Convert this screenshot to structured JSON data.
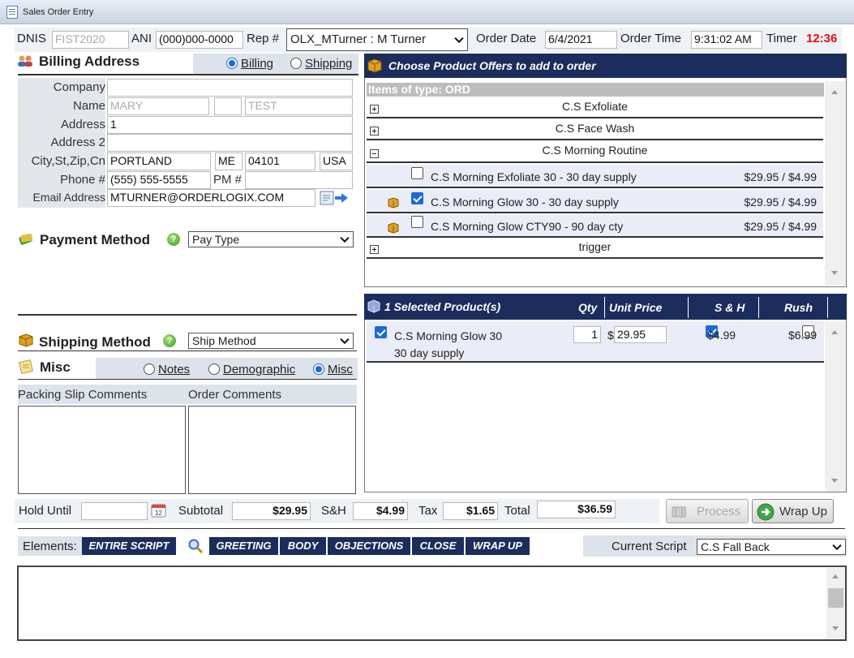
{
  "window": {
    "title": "Sales Order Entry"
  },
  "header": {
    "dnis_label": "DNIS",
    "dnis_value": "FIST2020",
    "ani_label": "ANI",
    "ani_value": "(000)000-0000",
    "rep_label": "Rep #",
    "rep_value": "OLX_MTurner : M Turner",
    "order_date_label": "Order Date",
    "order_date_value": "6/4/2021",
    "order_time_label": "Order Time",
    "order_time_value": "9:31:02 AM",
    "timer_label": "Timer",
    "timer_value": "12:36",
    "timer_color": "#e01010"
  },
  "billing": {
    "title": "Billing Address",
    "radio_billing": "Billing",
    "radio_shipping": "Shipping",
    "company_label": "Company",
    "company_value": "",
    "name_label": "Name",
    "first_name": "MARY",
    "middle_initial": "",
    "last_name": "TEST",
    "address_label": "Address",
    "address_value": "1",
    "address2_label": "Address 2",
    "address2_value": "",
    "city_label": "City,St,Zip,Cn",
    "city_value": "PORTLAND",
    "state_value": "ME",
    "zip_value": "04101",
    "country_value": "USA",
    "phone_label": "Phone #",
    "phone_value": "(555) 555-5555",
    "pm_label": "PM #",
    "pm_value": "",
    "email_label": "Email Address",
    "email_value": "MTURNER@ORDERLOGIX.COM"
  },
  "payment": {
    "title": "Payment Method",
    "select_value": "Pay Type"
  },
  "shipping": {
    "title": "Shipping Method",
    "select_value": "Ship Method"
  },
  "misc": {
    "title": "Misc",
    "radio_notes": "Notes",
    "radio_demographic": "Demographic",
    "radio_misc": "Misc",
    "packing_label": "Packing Slip Comments",
    "packing_value": "",
    "order_comments_label": "Order Comments",
    "order_comments_value": ""
  },
  "offers": {
    "title": "Choose Product Offers to add to order",
    "group_header": "Items of type: ORD",
    "groups": [
      {
        "label": "C.S Exfoliate",
        "expanded": false
      },
      {
        "label": "C.S Face Wash",
        "expanded": false
      },
      {
        "label": "C.S Morning Routine",
        "expanded": true
      },
      {
        "label": "trigger",
        "expanded": false
      }
    ],
    "items": [
      {
        "label": "C.S Morning Exfoliate 30 - 30 day supply",
        "price": "$29.95 / $4.99",
        "checked": false,
        "icon": false
      },
      {
        "label": "C.S Morning Glow 30 - 30 day supply",
        "price": "$29.95 / $4.99",
        "checked": true,
        "icon": true
      },
      {
        "label": "C.S Morning Glow CTY90 - 90 day cty",
        "price": "$29.95 / $4.99",
        "checked": false,
        "icon": true
      }
    ]
  },
  "selected": {
    "title": "1 Selected Product(s)",
    "col_qty": "Qty",
    "col_unit_price": "Unit Price",
    "col_sh": "S & H",
    "col_rush": "Rush",
    "rows": [
      {
        "name": "C.S Morning Glow 30",
        "sub": "30 day supply",
        "qty": "1",
        "currency": "$",
        "unit_price": "29.95",
        "sh": "$4.99",
        "sh_checked": true,
        "rush": "$6.99",
        "rush_checked": false
      }
    ]
  },
  "totals": {
    "hold_until_label": "Hold Until",
    "hold_until_value": "",
    "subtotal_label": "Subtotal",
    "subtotal_value": "$29.95",
    "sh_label": "S&H",
    "sh_value": "$4.99",
    "tax_label": "Tax",
    "tax_value": "$1.65",
    "total_label": "Total",
    "total_value": "$36.59"
  },
  "actions": {
    "process_label": "Process",
    "wrapup_label": "Wrap Up"
  },
  "script": {
    "elements_label": "Elements:",
    "buttons": [
      "ENTIRE SCRIPT",
      "GREETING",
      "BODY",
      "OBJECTIONS",
      "CLOSE",
      "WRAP UP"
    ],
    "current_label": "Current Script",
    "current_value": "C.S Fall Back",
    "text": ""
  }
}
